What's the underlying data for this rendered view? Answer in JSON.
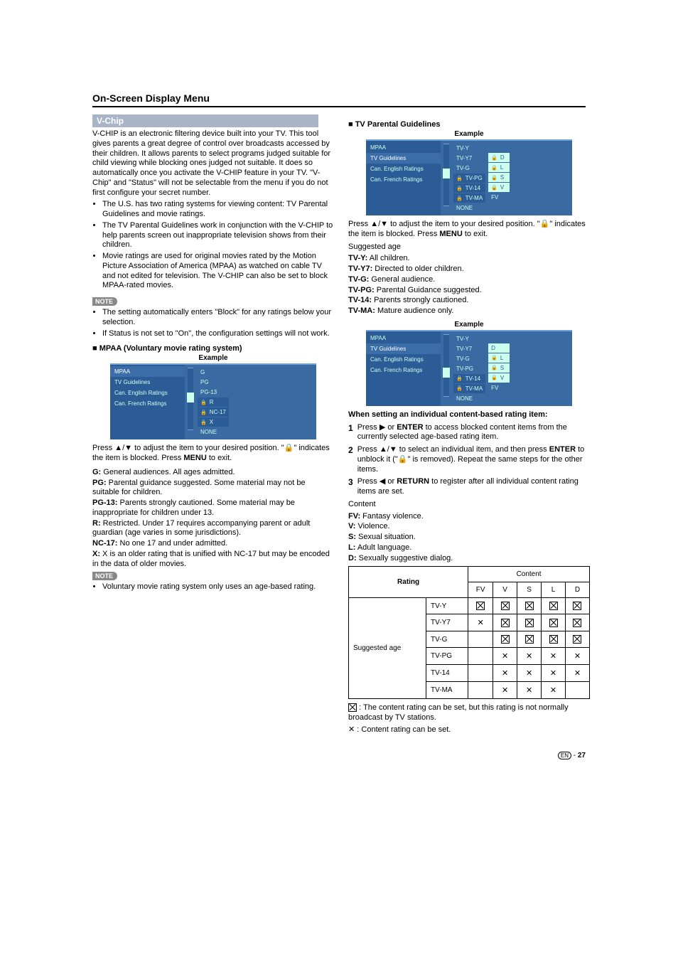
{
  "section_title": "On-Screen Display Menu",
  "vchip_header": "V-Chip",
  "vchip_intro": "V-CHIP is an electronic filtering device built into your TV. This tool gives parents a great degree of control over broadcasts accessed by their children. It allows parents to select programs judged suitable for child viewing while blocking ones judged not suitable. It does so automatically once you activate the V-CHIP feature in your TV. \"V-Chip\" and \"Status\" will not be selectable from the menu if you do not first configure your secret number.",
  "vchip_bullets": [
    "The U.S. has two rating systems for viewing content: TV Parental Guidelines and movie ratings.",
    "The TV Parental Guidelines work in conjunction with the V-CHIP to help parents screen out inappropriate television shows from their children.",
    "Movie ratings are used for original movies rated by the Motion Picture Association of America (MPAA) as watched on cable TV and not edited for television. The V-CHIP can also be set to block MPAA-rated movies."
  ],
  "note_label": "NOTE",
  "vchip_notes": [
    "The setting automatically enters \"Block\" for any ratings below your selection.",
    "If Status is not set to \"On\", the configuration settings will not work."
  ],
  "mpaa_heading": "MPAA (Voluntary movie rating system)",
  "example_label": "Example",
  "osd_left_items": [
    "MPAA",
    "TV Guidelines",
    "Can. English Ratings",
    "Can. French Ratings"
  ],
  "mpaa_ratings": [
    "G",
    "PG",
    "PG-13",
    "R",
    "NC-17",
    "X",
    "NONE"
  ],
  "mpaa_locked_rows": [
    3,
    4,
    5
  ],
  "mpaa_instr": "Press ▲/▼ to adjust the item to your desired position. \"🔒\" indicates the item is blocked. Press MENU to exit.",
  "mpaa_defs": [
    {
      "k": "G:",
      "v": " General audiences. All ages admitted."
    },
    {
      "k": "PG:",
      "v": " Parental guidance suggested. Some material may not be suitable for children."
    },
    {
      "k": "PG-13:",
      "v": " Parents strongly cautioned. Some material may be inappropriate for children under 13."
    },
    {
      "k": "R:",
      "v": " Restricted. Under 17 requires accompanying parent or adult guardian (age varies in some jurisdictions)."
    },
    {
      "k": "NC-17:",
      "v": " No one 17 and under admitted."
    },
    {
      "k": "X:",
      "v": " X is an older rating that is unified with NC-17 but may be encoded in the data of older movies."
    }
  ],
  "mpaa_note": "Voluntary movie rating system only uses an age-based rating.",
  "tvpg_heading": "TV Parental Guidelines",
  "tvpg_rows1": [
    "TV-Y",
    "TV-Y7",
    "TV-G",
    "TV-PG",
    "TV-14",
    "TV-MA",
    "NONE"
  ],
  "tvpg_badges1": [
    [
      "D",
      "L",
      "S",
      "V",
      "FV"
    ],
    [
      true,
      true,
      true,
      true,
      false
    ]
  ],
  "tvpg_instr": "Press ▲/▼ to adjust the item to your desired position. \"🔒\" indicates the item is blocked. Press MENU to exit.",
  "sugg_age_label": "Suggested age",
  "tvpg_defs": [
    {
      "k": "TV-Y:",
      "v": " All children."
    },
    {
      "k": "TV-Y7:",
      "v": " Directed to older children."
    },
    {
      "k": "TV-G:",
      "v": " General audience."
    },
    {
      "k": "TV-PG:",
      "v": " Parental Guidance suggested."
    },
    {
      "k": "TV-14:",
      "v": " Parents strongly cautioned."
    },
    {
      "k": "TV-MA:",
      "v": " Mature audience only."
    }
  ],
  "tvpg_rows2": [
    "TV-Y",
    "TV-Y7",
    "TV-G",
    "TV-PG",
    "TV-14",
    "TV-MA",
    "NONE"
  ],
  "tvpg_badges2": [
    [
      "D",
      "L",
      "S",
      "V",
      "FV"
    ],
    [
      false,
      true,
      true,
      true,
      false
    ]
  ],
  "indiv_heading": "When setting an individual content-based rating item:",
  "steps": [
    "Press ▶ or ENTER to access blocked content items from the currently selected age-based rating item.",
    "Press ▲/▼ to select an individual item, and then press ENTER to unblock it (\"🔒\" is removed). Repeat the same steps for the other items.",
    "Press ◀ or RETURN to register after all individual content rating items are set."
  ],
  "content_label": "Content",
  "content_defs": [
    {
      "k": "FV:",
      "v": " Fantasy violence."
    },
    {
      "k": "V:",
      "v": " Violence."
    },
    {
      "k": "S:",
      "v": " Sexual situation."
    },
    {
      "k": "L:",
      "v": " Adult language."
    },
    {
      "k": "D:",
      "v": " Sexually suggestive dialog."
    }
  ],
  "table": {
    "rating_hd": "Rating",
    "content_hd": "Content",
    "cols": [
      "FV",
      "V",
      "S",
      "L",
      "D"
    ],
    "grp": "Suggested age",
    "rows": [
      {
        "r": "TV-Y",
        "c": [
          "box",
          "box",
          "box",
          "box",
          "box"
        ]
      },
      {
        "r": "TV-Y7",
        "c": [
          "x",
          "box",
          "box",
          "box",
          "box"
        ]
      },
      {
        "r": "TV-G",
        "c": [
          "",
          "box",
          "box",
          "box",
          "box"
        ]
      },
      {
        "r": "TV-PG",
        "c": [
          "",
          "x",
          "x",
          "x",
          "x"
        ]
      },
      {
        "r": "TV-14",
        "c": [
          "",
          "x",
          "x",
          "x",
          "x"
        ]
      },
      {
        "r": "TV-MA",
        "c": [
          "",
          "x",
          "x",
          "x",
          ""
        ]
      }
    ]
  },
  "legend_box": ": The content rating can be set, but this rating is not normally broadcast by TV stations.",
  "legend_x": ": Content rating can be set.",
  "page_no": "27",
  "en_badge": "EN"
}
